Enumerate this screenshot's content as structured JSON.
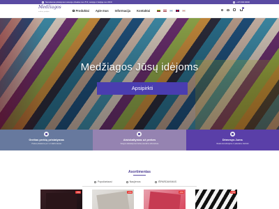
{
  "topbar": {
    "message": "Nemokamas pristatymas Lietuvoje užsakius nuo 75 €, Latvijoje ir Estijoje nuo 150 €",
    "phone": "+370 600 00000"
  },
  "header": {
    "logo": "Medžiagos",
    "logo_sub": "audinių prekyba",
    "nav": [
      {
        "label": "Produktai",
        "icon": "grid-icon"
      },
      {
        "label": "Apie mus"
      },
      {
        "label": "Informacija"
      },
      {
        "label": "Kontaktai"
      }
    ],
    "flags": [
      {
        "name": "lt",
        "colors": [
          "#fdb913",
          "#006a44",
          "#c1272d"
        ]
      },
      {
        "name": "lv",
        "colors": [
          "#9e3039",
          "#ffffff",
          "#9e3039"
        ]
      },
      {
        "name": "ee",
        "colors": [
          "#0072ce",
          "#000000",
          "#ffffff"
        ]
      },
      {
        "name": "gb",
        "colors": [
          "#012169",
          "#ffffff",
          "#c8102e"
        ]
      },
      {
        "name": "ru",
        "colors": [
          "#ffffff",
          "#0039a6",
          "#d52b1e"
        ]
      }
    ],
    "cart_count": "0"
  },
  "hero": {
    "title": "Medžiagos Jūsų idėjoms",
    "button": "Apsipirkti"
  },
  "features": [
    {
      "title": "Greitas prekių pristatymas",
      "desc": "Prekes pristatome per 1–3 darbo dienas"
    },
    {
      "title": "Atsiskaitymas už prekes",
      "desc": "Saugus atsiskaitymas banko pavedimu arba kortele"
    },
    {
      "title": "Dėmesys Jums",
      "desc": "Visada konsultuojame ir padedame išsirinkti"
    }
  ],
  "assortment": {
    "title": "Asortimentas",
    "tabs": [
      "Populiariausi",
      "Naujienos",
      "IŠPARDAVIMAS"
    ],
    "products": [
      {
        "badge": "-15%"
      },
      {
        "badge": "-15%"
      },
      {
        "badge": "-15%"
      },
      {
        "badge": "-15%"
      }
    ]
  },
  "colors": {
    "accent": "#5a4aa3",
    "button": "#4a3db0",
    "sale": "#e53935"
  }
}
